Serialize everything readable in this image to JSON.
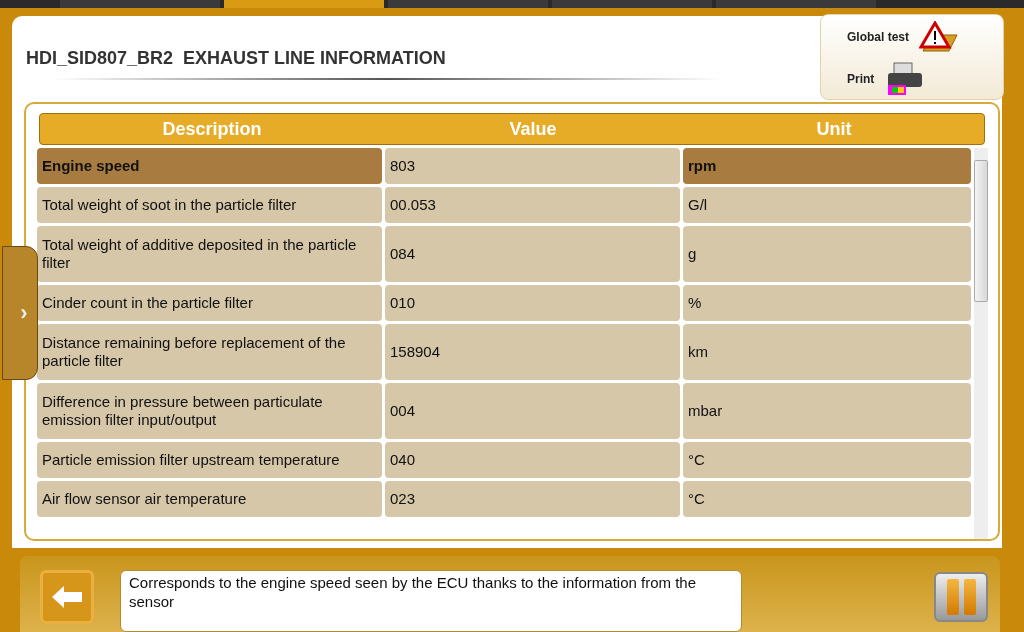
{
  "top_tabs": [
    {
      "selected": false
    },
    {
      "selected": true
    },
    {
      "selected": false
    },
    {
      "selected": false
    },
    {
      "selected": false
    }
  ],
  "title": "HDI_SID807_BR2  EXHAUST LINE INFORMATION",
  "actions": [
    {
      "kind": "warning",
      "label": "Global test"
    },
    {
      "kind": "printer",
      "label": "Print"
    }
  ],
  "side_tab": {
    "label": "›"
  },
  "table": {
    "columns": [
      "Description",
      "Value",
      "Unit"
    ],
    "rows": [
      {
        "description": "Engine speed",
        "value": "803",
        "unit": "rpm",
        "selected": true
      },
      {
        "description": "Total weight of soot in the particle filter",
        "value": "00.053",
        "unit": "G/l",
        "selected": false
      },
      {
        "description": "Total weight of additive deposited in the particle filter",
        "value": "084",
        "unit": "g",
        "selected": false
      },
      {
        "description": "Cinder count in the particle filter",
        "value": "010",
        "unit": "%",
        "selected": false
      },
      {
        "description": "Distance remaining before replacement of the particle filter",
        "value": "158904",
        "unit": "km",
        "selected": false
      },
      {
        "description": "Difference in pressure between particulate emission filter input/output",
        "value": "004",
        "unit": "mbar",
        "selected": false
      },
      {
        "description": "Particle emission filter upstream temperature",
        "value": "040",
        "unit": "°C",
        "selected": false
      },
      {
        "description": "Air flow sensor air temperature",
        "value": "023",
        "unit": "°C",
        "selected": false
      }
    ]
  },
  "help_text": "Corresponds to the engine speed seen by the ECU thanks to the information from the sensor"
}
